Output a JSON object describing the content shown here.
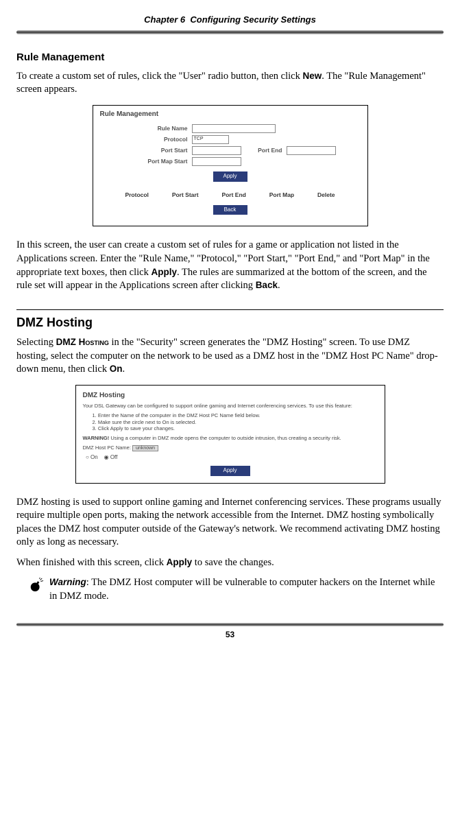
{
  "header": {
    "chapter": "Chapter 6",
    "title": "Configuring Security Settings"
  },
  "section1": {
    "heading": "Rule Management",
    "p1a": "To create a custom set of rules, click the \"User\" radio button, then click",
    "p1b": "New",
    "p1c": ". The \"Rule Management\" screen appears.",
    "p2a": "In this screen, the user can create a custom set of rules for a game or application not listed in the Applications screen. Enter the \"Rule Name,\" \"Protocol,\" \"Port Start,\" \"Port End,\" and \"Port Map\" in the appropriate text boxes, then click",
    "p2b": "Apply",
    "p2c": ". The rules are summarized at the bottom of the screen, and the rule set will appear in the Applications screen after clicking ",
    "p2d": "Back",
    "p2e": "."
  },
  "rm_screenshot": {
    "title": "Rule Management",
    "labels": {
      "rule_name": "Rule Name",
      "protocol": "Protocol",
      "protocol_val": "TCP",
      "port_start": "Port Start",
      "port_end": "Port End",
      "port_map_start": "Port Map Start"
    },
    "apply": "Apply",
    "cols": {
      "c1": "Protocol",
      "c2": "Port Start",
      "c3": "Port End",
      "c4": "Port Map",
      "c5": "Delete"
    },
    "back": "Back"
  },
  "section2": {
    "heading": "DMZ Hosting",
    "p1a": "Selecting ",
    "p1b": "DMZ Hosting",
    "p1c": " in the \"Security\" screen generates the \"",
    "p1d": "DMZ",
    "p1e": " Hosting\" screen. To use ",
    "p1f": "DMZ",
    "p1g": " hosting, select the computer on the network to be used as a ",
    "p1h": "DMZ",
    "p1i": " host in the \"",
    "p1j": "DMZ",
    "p1k": " Host ",
    "p1l": "PC",
    "p1m": " Name\" drop-down menu, then click ",
    "p1n": "On",
    "p1o": ".",
    "p2a": "DMZ",
    "p2b": " hosting is used to support online gaming and Internet conferencing services. These programs usually require multiple open ports, making the network accessible from the Internet. ",
    "p2c": "DMZ",
    "p2d": " hosting symbolically places the ",
    "p2e": "DMZ",
    "p2f": " host computer outside of the Gateway's network. We recommend activating ",
    "p2g": "DMZ",
    "p2h": " hosting only as long as necessary.",
    "p3a": "When finished with this screen, click ",
    "p3b": "Apply",
    "p3c": " to save the changes."
  },
  "dmz_screenshot": {
    "title": "DMZ Hosting",
    "intro": "Your DSL Gateway can be configured to support online gaming and Internet conferencing services. To use this feature:",
    "steps": {
      "s1": "1.   Enter the Name of the computer in the DMZ Host PC Name field below.",
      "s2": "2.   Make sure the circle next to On is selected.",
      "s3": "3.   Click Apply to save your changes."
    },
    "warn_label": "WARNING!",
    "warn_text": " Using a computer in DMZ mode opens the computer to outside intrusion, thus creating a security risk.",
    "host_label": "DMZ Host PC Name:",
    "host_val": "unknown",
    "radio_on": "On",
    "radio_off": "Off",
    "apply": "Apply"
  },
  "warning": {
    "label": "Warning",
    "t1": ": The ",
    "t2": "DMZ",
    "t3": " Host computer will be vulnerable to computer hackers on the Internet while in ",
    "t4": "DMZ",
    "t5": " mode."
  },
  "page_number": "53"
}
